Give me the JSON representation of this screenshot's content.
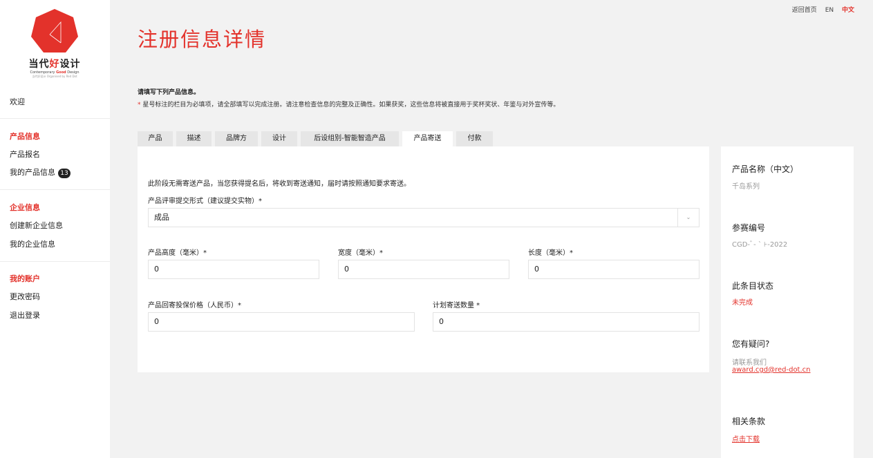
{
  "brand": {
    "name_part1": "当代",
    "name_part2": "好",
    "name_part3": "设计",
    "tagline_part1": "Contemporary ",
    "tagline_part2": "Good",
    "tagline_part3": " Design",
    "organizer": "当代好设计 Organised by Red Dot",
    "logo_color": "#e3322b"
  },
  "topnav": {
    "home": "返回首页",
    "lang_en": "EN",
    "lang_zh": "中文"
  },
  "sidebar": {
    "welcome": "欢迎",
    "product_section": {
      "title": "产品信息",
      "items": [
        {
          "label": "产品报名"
        },
        {
          "label": "我的产品信息",
          "badge": "13"
        }
      ]
    },
    "company_section": {
      "title": "企业信息",
      "items": [
        {
          "label": "创建新企业信息"
        },
        {
          "label": "我的企业信息"
        }
      ]
    },
    "account_section": {
      "title": "我的账户",
      "items": [
        {
          "label": "更改密码"
        },
        {
          "label": "退出登录"
        }
      ]
    }
  },
  "page": {
    "title": "注册信息详情",
    "intro": "请填写下列产品信息。",
    "note_star": "*",
    "note": " 星号标注的栏目为必填项，请全部填写以完成注册。请注意检查信息的完整及正确性。如果获奖，这些信息将被直接用于奖杯奖状、年鉴与对外宣传等。"
  },
  "tabs": [
    {
      "label": "产品",
      "active": false
    },
    {
      "label": "描述",
      "active": false
    },
    {
      "label": "品牌方",
      "active": false
    },
    {
      "label": "设计",
      "active": false
    },
    {
      "label": "后设组别-智能智造产品",
      "active": false
    },
    {
      "label": "产品寄送",
      "active": true
    },
    {
      "label": "付款",
      "active": false
    }
  ],
  "form": {
    "notice": "此阶段无需寄送产品，当您获得提名后，将收到寄送通知，届时请按照通知要求寄送。",
    "submit_form": {
      "label": "产品评审提交形式（建议提交实物）*",
      "value": "成品"
    },
    "height": {
      "label": "产品高度（毫米）*",
      "value": "0"
    },
    "width": {
      "label": "宽度（毫米）*",
      "value": "0"
    },
    "length": {
      "label": "长度（毫米）*",
      "value": "0"
    },
    "insured_value": {
      "label": "产品回寄投保价格（人民币）*",
      "value": "0"
    },
    "quantity": {
      "label": "计划寄送数量 *",
      "value": "0"
    }
  },
  "info_panel": {
    "product_name_title": "产品名称（中文）",
    "product_name_value": "千岛系列",
    "ref_title": "参赛编号",
    "ref_value": "CGD-ﾞ-     ˋ      ⊦-2022",
    "status_title": "此条目状态",
    "status_value": "未完成",
    "question_title": "您有疑问?",
    "contact_text": "请联系我们",
    "contact_email": "award.cgd@red-dot.cn",
    "terms_title": "相关条款",
    "terms_link": "点击下载"
  }
}
